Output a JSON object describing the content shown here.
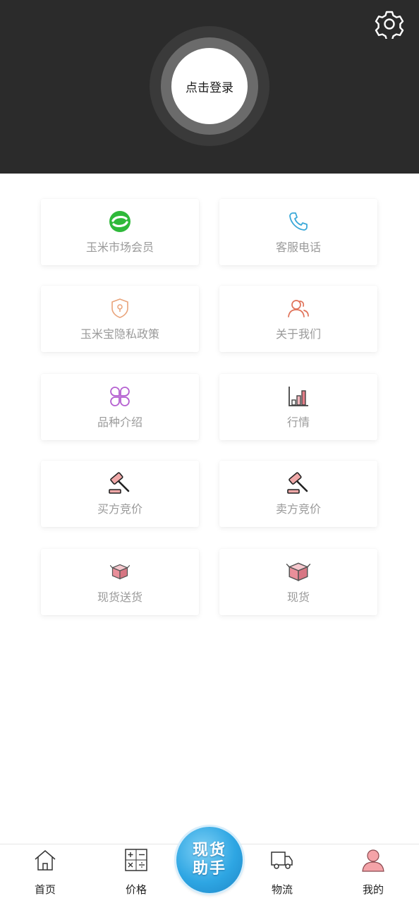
{
  "header": {
    "login_label": "点击登录",
    "settings_icon": "gear-icon"
  },
  "menu": [
    {
      "label": "玉米市场会员",
      "icon": "member-refresh-icon",
      "color": "#2fb93a"
    },
    {
      "label": "客服电话",
      "icon": "phone-icon",
      "color": "#3aa8d8"
    },
    {
      "label": "玉米宝隐私政策",
      "icon": "shield-icon",
      "color": "#e9a37a"
    },
    {
      "label": "关于我们",
      "icon": "people-icon",
      "color": "#e0735a"
    },
    {
      "label": "品种介绍",
      "icon": "clover-icon",
      "color": "#b45fd0"
    },
    {
      "label": "行情",
      "icon": "bar-chart-icon",
      "color": "#e37d87"
    },
    {
      "label": "买方竞价",
      "icon": "gavel-icon",
      "color": "#f0a8a8"
    },
    {
      "label": "卖方竞价",
      "icon": "gavel-icon",
      "color": "#f0a8a8"
    },
    {
      "label": "现货送货",
      "icon": "box-icon",
      "color": "#e98f9a"
    },
    {
      "label": "现货",
      "icon": "box-icon",
      "color": "#e98f9a"
    }
  ],
  "tabbar": {
    "home": "首页",
    "price": "价格",
    "center_line1": "现货",
    "center_line2": "助手",
    "logistics": "物流",
    "mine": "我的",
    "active_color": "#f4a3a8"
  }
}
